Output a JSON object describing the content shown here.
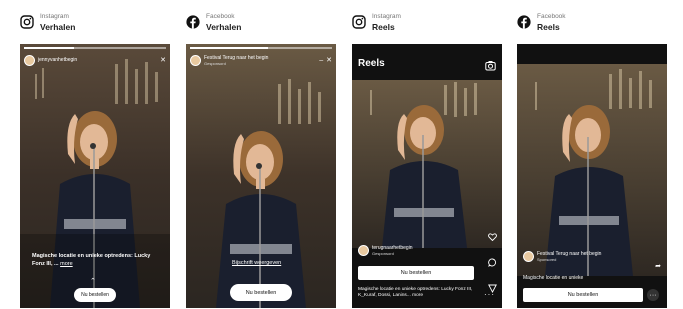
{
  "columns": [
    {
      "platform": "Instagram",
      "format": "Verhalen",
      "account": "jennyvanhetbegin",
      "caption": "Magische locatie en unieke optredens: Lucky Fonz III, ...",
      "more": "more",
      "cta": "Nu bestellen"
    },
    {
      "platform": "Facebook",
      "format": "Verhalen",
      "account": "Festival Terug naar het begin",
      "sponsored": "Gesponsord",
      "link": "Bijschrift weergeven",
      "cta": "Nu bestellen"
    },
    {
      "platform": "Instagram",
      "format": "Reels",
      "screen_title": "Reels",
      "account": "terugnaarhetbegin",
      "sponsored": "Gesponsord",
      "cta": "Nu bestellen",
      "caption": "Magische locatie en unieke optredens: Lucky Fonz III, K_Kuraf, Dossi, Lanins...",
      "more": "more"
    },
    {
      "platform": "Facebook",
      "format": "Reels",
      "account": "Festival Terug naar het begin",
      "sponsored": "Sponsored",
      "caption": "Magische locatie en unieke",
      "cta": "Nu bestellen"
    }
  ],
  "colors": {
    "instagram_icon": "#111111",
    "facebook_icon": "#111111",
    "phone_background": "#111111",
    "button_background": "#ffffff"
  },
  "icons": [
    "instagram-icon",
    "facebook-icon",
    "close-icon",
    "camera-icon",
    "heart-icon",
    "comment-icon",
    "send-icon",
    "more-icon",
    "chevron-up-icon"
  ]
}
